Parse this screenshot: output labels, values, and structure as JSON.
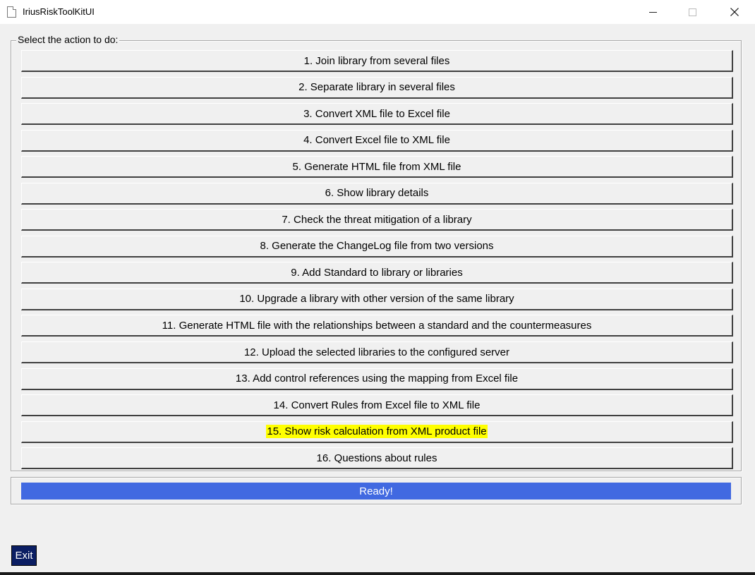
{
  "window": {
    "title": "IriusRiskToolKitUI",
    "icon": "document-icon"
  },
  "group": {
    "legend": "Select the action to do:"
  },
  "actions": [
    {
      "label": "1. Join library from several files",
      "highlighted": false
    },
    {
      "label": "2. Separate library in several files",
      "highlighted": false
    },
    {
      "label": "3. Convert XML file to Excel file",
      "highlighted": false
    },
    {
      "label": "4. Convert Excel file to XML file",
      "highlighted": false
    },
    {
      "label": "5. Generate HTML file from XML file",
      "highlighted": false
    },
    {
      "label": "6. Show library details",
      "highlighted": false
    },
    {
      "label": "7. Check the threat mitigation of a library",
      "highlighted": false
    },
    {
      "label": "8. Generate the ChangeLog file from two versions",
      "highlighted": false
    },
    {
      "label": "9. Add Standard to library or libraries",
      "highlighted": false
    },
    {
      "label": "10. Upgrade a library with other version of the same library",
      "highlighted": false
    },
    {
      "label": "11. Generate HTML file with the relationships between a standard and the countermeasures",
      "highlighted": false
    },
    {
      "label": "12. Upload the selected libraries to the configured server",
      "highlighted": false
    },
    {
      "label": "13. Add control references using the mapping from Excel file",
      "highlighted": false
    },
    {
      "label": "14. Convert Rules from Excel file to XML file",
      "highlighted": false
    },
    {
      "label": "15. Show risk calculation from XML product file",
      "highlighted": true
    },
    {
      "label": "16. Questions about rules",
      "highlighted": false
    }
  ],
  "status": {
    "text": "Ready!",
    "color": "#4169e1"
  },
  "exit": {
    "label": "Exit",
    "color": "#0b1e63"
  },
  "colors": {
    "highlight": "#ffff00",
    "background": "#f0f0f0"
  }
}
